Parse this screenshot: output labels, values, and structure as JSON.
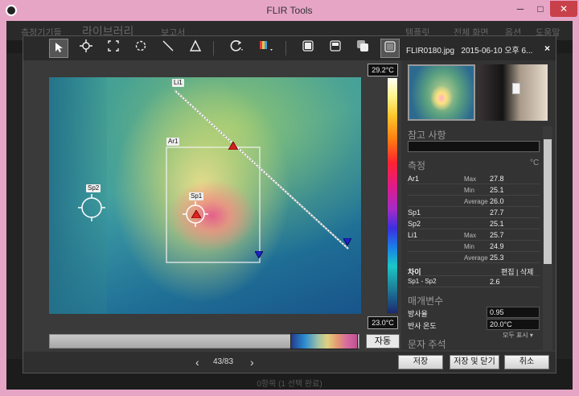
{
  "window": {
    "title": "FLIR Tools"
  },
  "background_app": {
    "nav": [
      "측정기기들",
      "라이브러리",
      "보고서",
      "템플릿",
      "전체 화면",
      "옵션",
      "도움말"
    ],
    "status": "0항목 (1 선택 완료)"
  },
  "toolbar": {
    "tools": [
      "select-icon",
      "spot-icon",
      "box-icon",
      "ellipse-icon",
      "line-icon",
      "delta-icon",
      "rotate-icon",
      "palette-icon",
      "fusion-icon-1",
      "fusion-icon-2",
      "fusion-icon-3",
      "fusion-icon-4"
    ]
  },
  "image": {
    "markers": {
      "line": "Li1",
      "area": "Ar1",
      "spot1": "Sp1",
      "spot2": "Sp2"
    }
  },
  "scale": {
    "max": "29.2°C",
    "min": "23.0°C",
    "auto": "자동"
  },
  "navigation": {
    "counter": "43/83",
    "prev": "‹",
    "next": "›"
  },
  "buttons": {
    "save": "저장",
    "save_close": "저장 및 닫기",
    "cancel": "취소"
  },
  "panel": {
    "file": "FLIR0180.jpg",
    "date": "2015-06-10 오후 6...",
    "close": "×",
    "notes_title": "참고 사항",
    "measure_title": "측정",
    "measure_unit": "°C",
    "measurements": [
      {
        "name": "Ar1",
        "stat": "Max",
        "value": "27.8"
      },
      {
        "name": "",
        "stat": "Min",
        "value": "25.1"
      },
      {
        "name": "",
        "stat": "Average",
        "value": "26.0"
      },
      {
        "name": "Sp1",
        "stat": "",
        "value": "27.7"
      },
      {
        "name": "Sp2",
        "stat": "",
        "value": "25.1"
      },
      {
        "name": "Li1",
        "stat": "Max",
        "value": "25.7"
      },
      {
        "name": "",
        "stat": "Min",
        "value": "24.9"
      },
      {
        "name": "",
        "stat": "Average",
        "value": "25.3"
      }
    ],
    "diff_title": "차이",
    "diff_actions": "편집 | 삭제",
    "diff_row": {
      "name": "Sp1 - Sp2",
      "value": "2.6"
    },
    "params_title": "매개변수",
    "params": [
      {
        "key": "방사율",
        "value": "0.95"
      },
      {
        "key": "반사 온도",
        "value": "20.0°C"
      }
    ],
    "show_all": "모두 표시 ▾",
    "text_notes_title": "문자 주석"
  }
}
